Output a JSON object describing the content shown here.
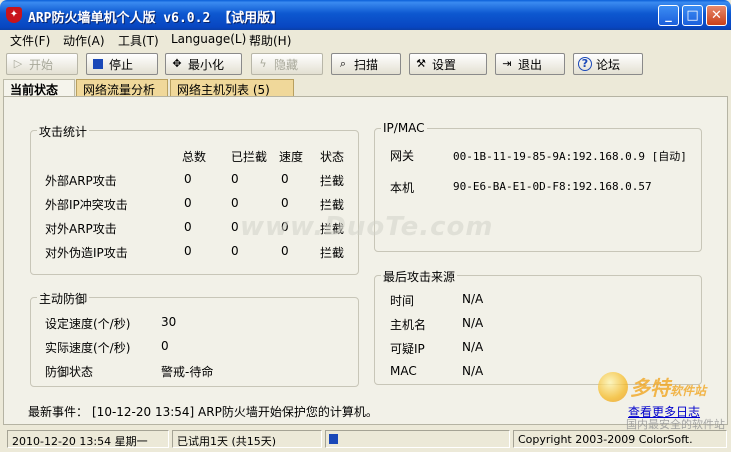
{
  "window": {
    "title": "ARP防火墙单机个人版 v6.0.2 【试用版】",
    "app_icon": "shield-icon",
    "controls": [
      "minimize",
      "maximize",
      "close"
    ]
  },
  "menu": [
    {
      "label": "文件(F)"
    },
    {
      "label": "动作(A)"
    },
    {
      "label": "工具(T)"
    },
    {
      "label": "Language(L)"
    },
    {
      "label": "帮助(H)"
    }
  ],
  "toolbar": [
    {
      "label": "开始",
      "icon": "play-icon",
      "enabled": false
    },
    {
      "label": "停止",
      "icon": "stop-icon",
      "enabled": true
    },
    {
      "label": "最小化",
      "icon": "minimize-arrows-icon",
      "enabled": true
    },
    {
      "label": "隐藏",
      "icon": "lightning-icon",
      "enabled": false
    },
    {
      "label": "扫描",
      "icon": "magnifier-icon",
      "enabled": true
    },
    {
      "label": "设置",
      "icon": "settings-tool-icon",
      "enabled": true
    },
    {
      "label": "退出",
      "icon": "exit-door-icon",
      "enabled": true
    },
    {
      "label": "论坛",
      "icon": "help-circle-icon",
      "enabled": true
    }
  ],
  "tabs": [
    {
      "label": "当前状态",
      "active": true
    },
    {
      "label": "网络流量分析",
      "active": false
    },
    {
      "label": "网络主机列表 (5)",
      "active": false
    }
  ],
  "attack_stats": {
    "title": "攻击统计",
    "headers": [
      "总数",
      "已拦截",
      "速度",
      "状态"
    ],
    "rows": [
      {
        "name": "外部ARP攻击",
        "total": "0",
        "blocked": "0",
        "speed": "0",
        "status": "拦截"
      },
      {
        "name": "外部IP冲突攻击",
        "total": "0",
        "blocked": "0",
        "speed": "0",
        "status": "拦截"
      },
      {
        "name": "对外ARP攻击",
        "total": "0",
        "blocked": "0",
        "speed": "0",
        "status": "拦截"
      },
      {
        "name": "对外伪造IP攻击",
        "total": "0",
        "blocked": "0",
        "speed": "0",
        "status": "拦截"
      }
    ]
  },
  "ip_mac": {
    "title": "IP/MAC",
    "gateway_label": "网关",
    "gateway_value": "00-1B-11-19-85-9A:192.168.0.9 [自动]",
    "local_label": "本机",
    "local_value": "90-E6-BA-E1-0D-F8:192.168.0.57"
  },
  "active_defense": {
    "title": "主动防御",
    "rows": [
      {
        "label": "设定速度(个/秒)",
        "value": "30"
      },
      {
        "label": "实际速度(个/秒)",
        "value": "0"
      },
      {
        "label": "防御状态",
        "value": "警戒-待命"
      }
    ]
  },
  "last_attack": {
    "title": "最后攻击来源",
    "rows": [
      {
        "label": "时间",
        "value": "N/A"
      },
      {
        "label": "主机名",
        "value": "N/A"
      },
      {
        "label": "可疑IP",
        "value": "N/A"
      },
      {
        "label": "MAC",
        "value": "N/A"
      }
    ]
  },
  "latest_event": {
    "label": "最新事件：",
    "text": "[10-12-20 13:54] ARP防火墙开始保护您的计算机。",
    "more_link": "查看更多日志"
  },
  "statusbar": {
    "datetime": "2010-12-20 13:54 星期一",
    "trial": "已试用1天 (共15天)",
    "progress_fraction": 0.05,
    "copyright": "Copyright 2003-2009 ColorSoft."
  },
  "overlays": {
    "watermark": "www.DuoTe.com",
    "logo_text": "多特",
    "logo_suffix": "软件站",
    "logo_sub": "国内最安全的软件站"
  }
}
